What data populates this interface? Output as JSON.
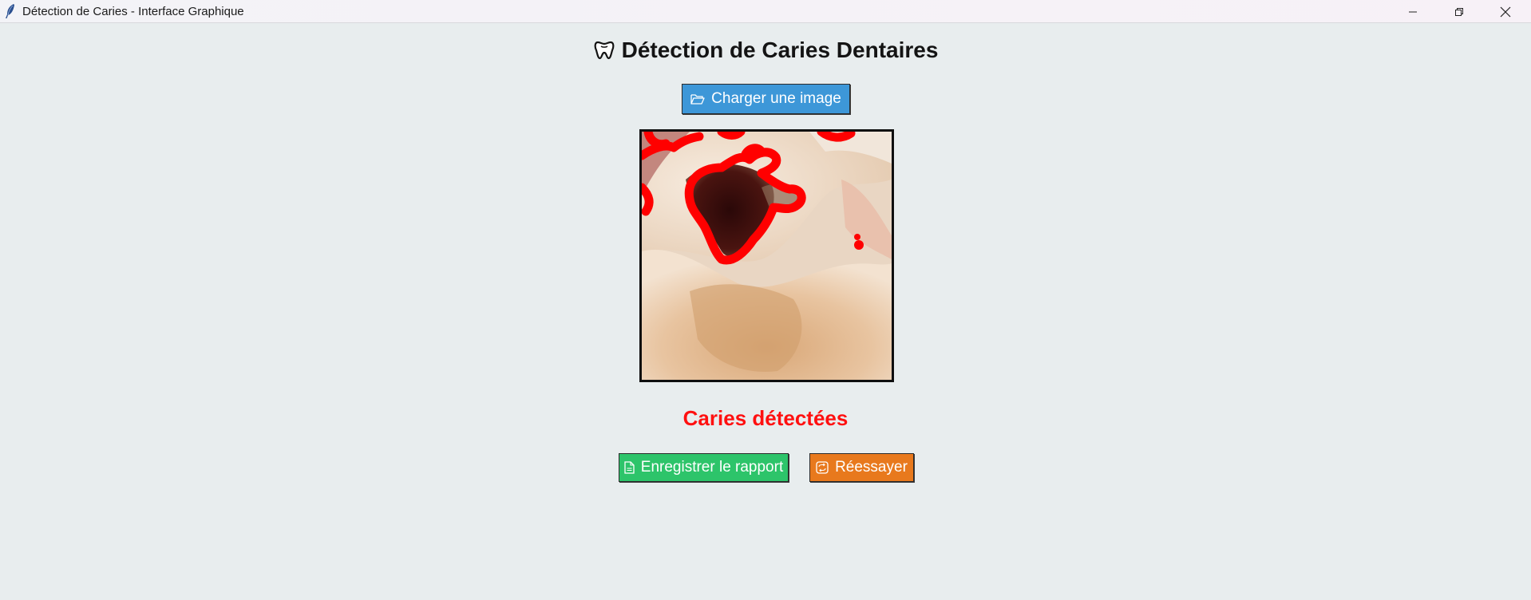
{
  "window": {
    "title": "Détection de Caries - Interface Graphique",
    "controls": {
      "minimize": "minimize-icon",
      "maximize": "restore-icon",
      "close": "close-icon"
    }
  },
  "header": {
    "icon": "tooth-icon",
    "title": "Détection de Caries Dentaires"
  },
  "load_button": {
    "icon": "folder-open-icon",
    "label": "Charger une image"
  },
  "result": {
    "status": "Caries détectées",
    "status_color": "#ff1010"
  },
  "actions": {
    "save": {
      "icon": "document-icon",
      "label": "Enregistrer le rapport",
      "color": "#2dc46a"
    },
    "retry": {
      "icon": "retry-icon",
      "label": "Réessayer",
      "color": "#e8791d"
    }
  },
  "colors": {
    "background": "#e8edee",
    "load_button": "#3d97d8",
    "detection_outline": "#ff0000"
  }
}
